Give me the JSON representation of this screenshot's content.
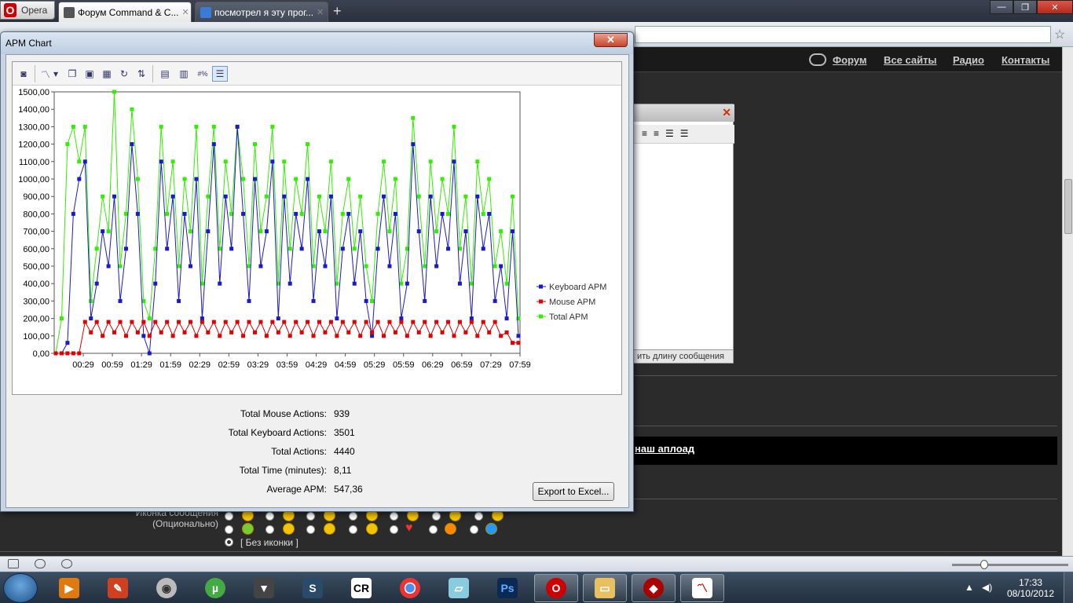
{
  "browser": {
    "opera_label": "Opera",
    "tabs": [
      {
        "label": "Форум Command & C..."
      },
      {
        "label": "посмотрел я эту прог..."
      }
    ],
    "new_tab": "+"
  },
  "site": {
    "nav": {
      "forum": "Форум",
      "all_sites": "Все сайты",
      "radio": "Радио",
      "contacts": "Контакты"
    },
    "editor_footer": "ить длину сообщения",
    "upload_link": "наш аплоад",
    "icons_label_line1": "Иконка сообщения",
    "icons_label_line2": "(Опционально)",
    "no_icon": "[ Без иконки ]"
  },
  "apm_window": {
    "title": "APM Chart",
    "close": "✕",
    "export_button": "Export to Excel...",
    "stats": [
      {
        "label": "Total Mouse Actions:",
        "value": "939"
      },
      {
        "label": "Total Keyboard Actions:",
        "value": "3501"
      },
      {
        "label": "Total Actions:",
        "value": "4440"
      },
      {
        "label": "Total Time (minutes):",
        "value": "8,11"
      },
      {
        "label": "Average APM:",
        "value": "547,36"
      }
    ]
  },
  "chart_data": {
    "type": "line",
    "title": "",
    "xlabel": "",
    "ylabel": "",
    "ylim": [
      0,
      1500
    ],
    "yticks": [
      "0,00",
      "100,00",
      "200,00",
      "300,00",
      "400,00",
      "500,00",
      "600,00",
      "700,00",
      "800,00",
      "900,00",
      "1000,00",
      "1100,00",
      "1200,00",
      "1300,00",
      "1400,00",
      "1500,00"
    ],
    "xticks": [
      "00:29",
      "00:59",
      "01:29",
      "01:59",
      "02:29",
      "02:59",
      "03:29",
      "03:59",
      "04:29",
      "04:59",
      "05:29",
      "05:59",
      "06:29",
      "06:59",
      "07:29",
      "07:59"
    ],
    "legend_position": "right",
    "colors": {
      "Keyboard APM": "#1a1acc",
      "Mouse APM": "#e00000",
      "Total APM": "#33ee00"
    },
    "series": [
      {
        "name": "Keyboard APM",
        "values": [
          0,
          0,
          60,
          800,
          1000,
          1100,
          200,
          400,
          700,
          500,
          900,
          300,
          600,
          1200,
          800,
          100,
          0,
          400,
          1100,
          600,
          900,
          300,
          800,
          500,
          1000,
          200,
          700,
          1200,
          400,
          900,
          600,
          1300,
          800,
          300,
          1000,
          500,
          700,
          1100,
          200,
          900,
          400,
          800,
          600,
          1000,
          300,
          700,
          500,
          900,
          200,
          600,
          800,
          400,
          700,
          300,
          100,
          600,
          900,
          500,
          800,
          200,
          400,
          1200,
          700,
          300,
          900,
          500,
          800,
          600,
          1100,
          400,
          700,
          200,
          900,
          600,
          800,
          300,
          500,
          200,
          700,
          100
        ]
      },
      {
        "name": "Mouse APM",
        "values": [
          0,
          0,
          0,
          0,
          0,
          180,
          120,
          180,
          100,
          180,
          120,
          180,
          100,
          180,
          120,
          180,
          100,
          180,
          120,
          180,
          100,
          180,
          120,
          180,
          100,
          180,
          120,
          180,
          100,
          180,
          120,
          180,
          100,
          180,
          120,
          180,
          100,
          180,
          120,
          180,
          100,
          180,
          120,
          180,
          100,
          180,
          120,
          180,
          100,
          180,
          120,
          180,
          100,
          180,
          120,
          180,
          100,
          180,
          120,
          180,
          100,
          180,
          120,
          180,
          100,
          180,
          120,
          180,
          100,
          180,
          120,
          180,
          100,
          180,
          120,
          180,
          100,
          120,
          60,
          60
        ]
      },
      {
        "name": "Total APM",
        "values": [
          0,
          200,
          1200,
          1300,
          1100,
          1300,
          300,
          600,
          900,
          700,
          1500,
          500,
          800,
          1400,
          1000,
          300,
          200,
          600,
          1300,
          800,
          1100,
          500,
          1000,
          700,
          1300,
          400,
          900,
          1300,
          600,
          1100,
          800,
          1300,
          1000,
          500,
          1200,
          700,
          900,
          1300,
          400,
          1100,
          600,
          1000,
          800,
          1200,
          500,
          900,
          700,
          1100,
          400,
          800,
          1000,
          600,
          900,
          500,
          300,
          800,
          1100,
          700,
          1000,
          400,
          600,
          1350,
          900,
          500,
          1100,
          700,
          1000,
          800,
          1300,
          600,
          900,
          400,
          1100,
          800,
          1000,
          500,
          700,
          400,
          900,
          200
        ]
      }
    ]
  },
  "taskbar": {
    "time": "17:33",
    "date": "08/10/2012"
  }
}
